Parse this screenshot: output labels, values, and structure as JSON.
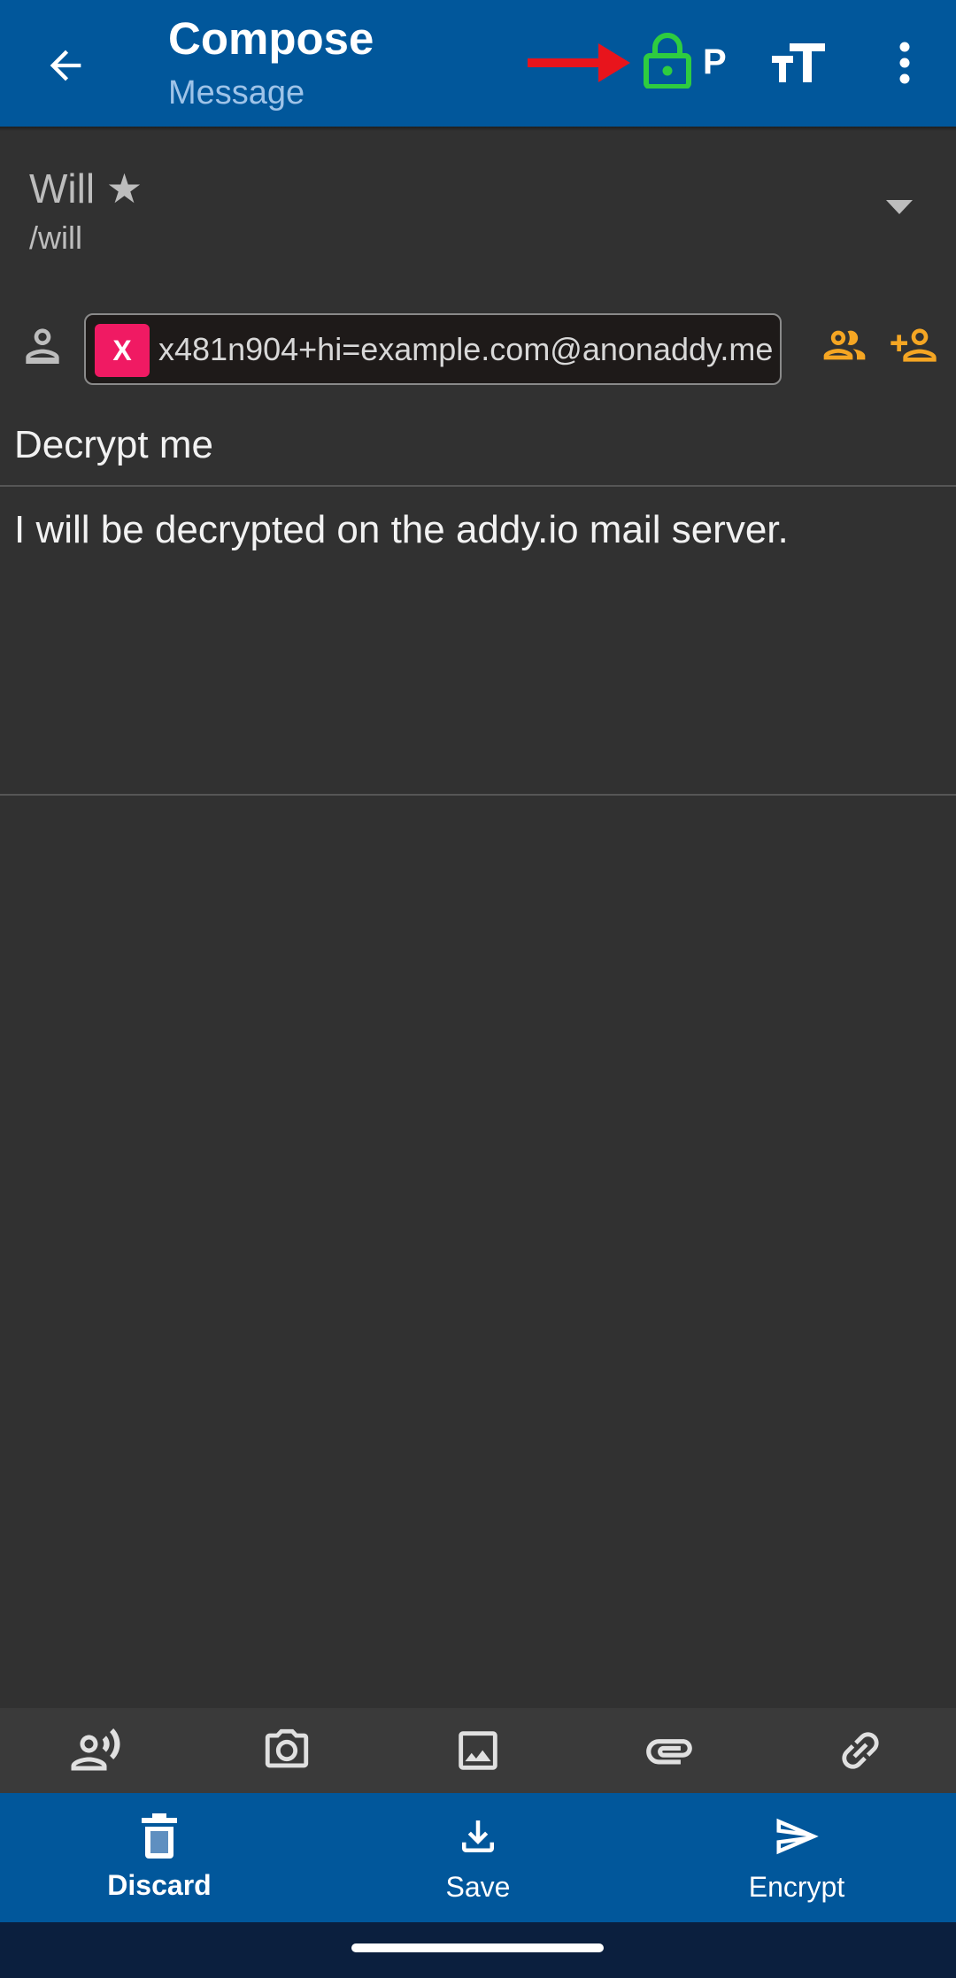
{
  "app_bar": {
    "title": "Compose",
    "subtitle": "Message",
    "pgp_indicator": "P",
    "icons": [
      "back-arrow-icon",
      "red-arrow-annotation",
      "lock-icon",
      "text-size-icon",
      "more-vert-icon"
    ],
    "colors": {
      "bar": "#01579b",
      "lock": "#2ecc40",
      "annotation": "#e8141c"
    }
  },
  "from": {
    "name": "Will ★",
    "handle": "/will"
  },
  "to": {
    "chip_initial": "X",
    "chip_address": "x481n904+hi=example.com@anonaddy.me",
    "chip_color": "#f01a63",
    "accent_color": "#f5a623"
  },
  "subject": "Decrypt me",
  "body": "I will be decrypted on the addy.io mail server.",
  "attachments": {
    "icons": [
      "voice-record-icon",
      "camera-icon",
      "image-icon",
      "attach-file-icon",
      "link-icon"
    ]
  },
  "actions": {
    "discard": "Discard",
    "save": "Save",
    "encrypt": "Encrypt"
  }
}
